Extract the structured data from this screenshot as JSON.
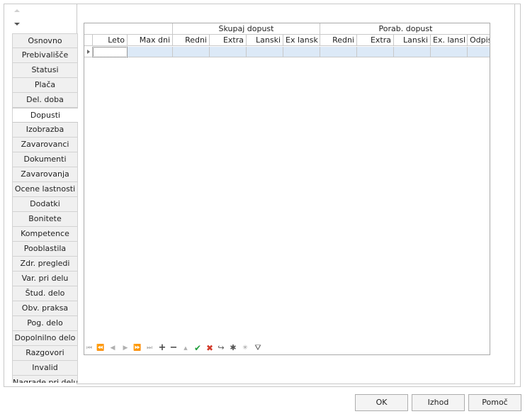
{
  "tabs": [
    {
      "label": "Osnovno"
    },
    {
      "label": "Prebivališče"
    },
    {
      "label": "Statusi"
    },
    {
      "label": "Plača"
    },
    {
      "label": "Del. doba"
    },
    {
      "label": "Dopusti",
      "active": true
    },
    {
      "label": "Izobrazba"
    },
    {
      "label": "Zavarovanci"
    },
    {
      "label": "Dokumenti"
    },
    {
      "label": "Zavarovanja"
    },
    {
      "label": "Ocene lastnosti"
    },
    {
      "label": "Dodatki"
    },
    {
      "label": "Bonitete"
    },
    {
      "label": "Kompetence"
    },
    {
      "label": "Pooblastila"
    },
    {
      "label": "Zdr. pregledi"
    },
    {
      "label": "Var. pri delu"
    },
    {
      "label": "Štud. delo"
    },
    {
      "label": "Obv. praksa"
    },
    {
      "label": "Pog. delo"
    },
    {
      "label": "Dopolnilno delo"
    },
    {
      "label": "Razgovori"
    },
    {
      "label": "Invalid"
    },
    {
      "label": "Nagrade pri delu"
    }
  ],
  "grid": {
    "bands": {
      "skupaj": "Skupaj dopust",
      "porab": "Porab. dopust"
    },
    "columns": {
      "leto": "Leto",
      "max_dni": "Max dni",
      "s_redni": "Redni",
      "s_extra": "Extra",
      "s_lanski": "Lanski",
      "s_ex_lansk": "Ex lansk",
      "p_redni": "Redni",
      "p_extra": "Extra",
      "p_lanski": "Lanski",
      "p_ex_lansl": "Ex. lansl",
      "p_odpis": "Odpis"
    }
  },
  "navigator": {
    "buttons": [
      "⏮",
      "⏪",
      "◀",
      "▶",
      "⏩",
      "⏭",
      "+",
      "−",
      "▲",
      "✔",
      "✖",
      "↪",
      "✱",
      "✳",
      "⛛"
    ]
  },
  "buttons": {
    "ok": "OK",
    "izhod": "Izhod",
    "pomoc": "Pomoč"
  }
}
